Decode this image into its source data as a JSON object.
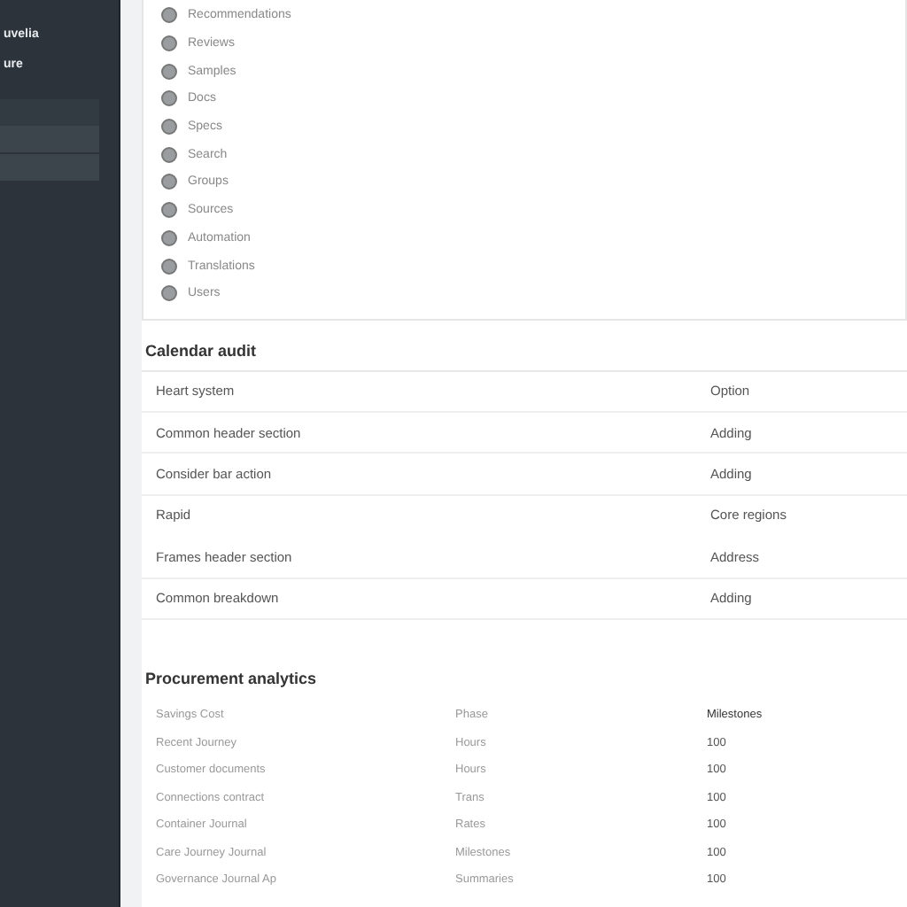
{
  "sidebar": {
    "items": [
      {
        "label": "uvelia"
      },
      {
        "label": "ure"
      }
    ]
  },
  "options": [
    {
      "label": "Recommendations",
      "selected": false
    },
    {
      "label": "Reviews",
      "selected": false
    },
    {
      "label": "Samples",
      "selected": false
    },
    {
      "label": "Docs",
      "selected": false
    },
    {
      "label": "Specs",
      "selected": false
    },
    {
      "label": "Search",
      "selected": false
    },
    {
      "label": "Groups",
      "selected": false
    },
    {
      "label": "Sources",
      "selected": false
    },
    {
      "label": "Automation",
      "selected": false
    },
    {
      "label": "Translations",
      "selected": false
    },
    {
      "label": "Users",
      "selected": false
    }
  ],
  "calendar": {
    "title": "Calendar audit",
    "rows": [
      [
        "Heart system",
        "Option"
      ],
      [
        "Common header section",
        "Adding"
      ],
      [
        "Consider bar action",
        "Adding"
      ],
      [
        "Rapid",
        "Core regions"
      ],
      [
        "Frames header section",
        "Address"
      ],
      [
        "Common breakdown",
        "Adding"
      ]
    ]
  },
  "procurement": {
    "title": "Procurement analytics",
    "rows": [
      [
        "Savings Cost",
        "Phase",
        "Milestones"
      ],
      [
        "Recent Journey",
        "Hours",
        "100"
      ],
      [
        "Customer documents",
        "Hours",
        "100"
      ],
      [
        "Connections contract",
        "Trans",
        "100"
      ],
      [
        "Container Journal",
        "Rates",
        "100"
      ],
      [
        "Care Journey Journal",
        "Milestones",
        "100"
      ],
      [
        "Governance Journal Ap",
        "Summaries",
        "100"
      ]
    ]
  }
}
